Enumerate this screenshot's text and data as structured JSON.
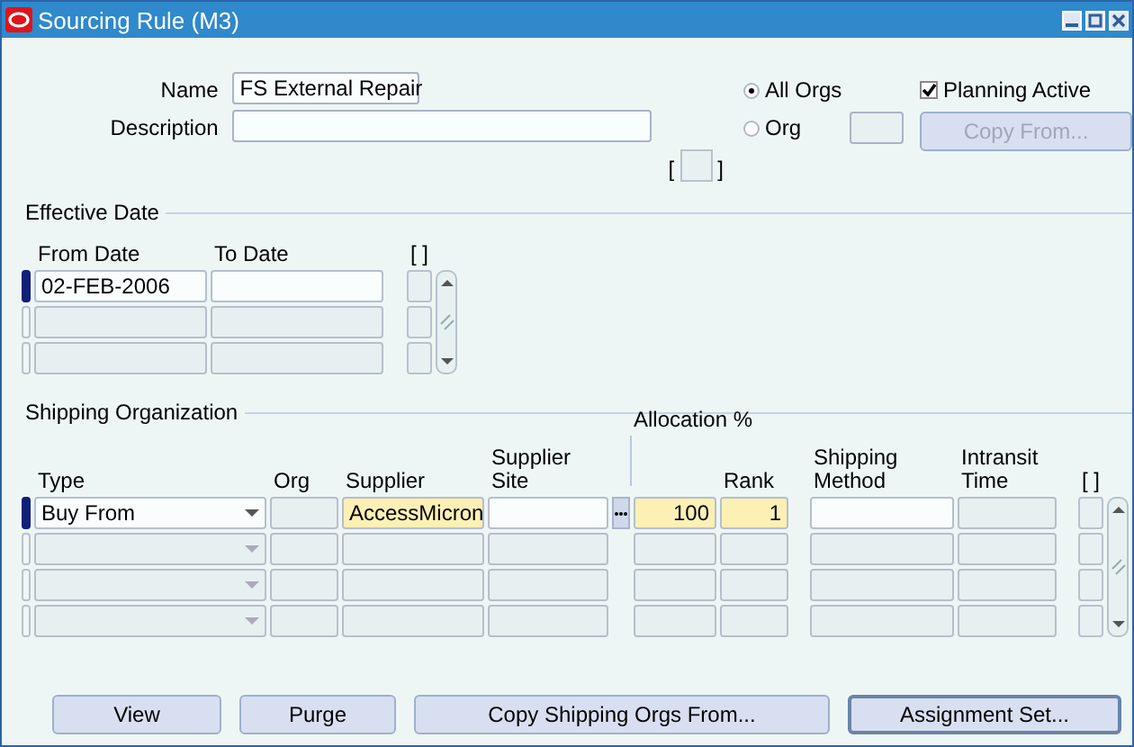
{
  "window": {
    "title": "Sourcing Rule (M3)"
  },
  "header": {
    "name_label": "Name",
    "name": "FS External Repair",
    "description_label": "Description",
    "flex_open": "[",
    "flex_close": "]",
    "scope": [
      {
        "label": "All Orgs",
        "selected": true
      },
      {
        "label": "Org",
        "selected": false
      }
    ],
    "planning_active": {
      "label": "Planning Active",
      "checked": true
    },
    "copy_from": {
      "label": "Copy From...",
      "disabled": true
    }
  },
  "effective_date": {
    "title": "Effective Date",
    "columns": [
      "From Date",
      "To Date"
    ],
    "flex_header": "[ ]",
    "rows": [
      {
        "selected": true,
        "from_date": "02-FEB-2006"
      },
      {
        "selected": false
      },
      {
        "selected": false
      }
    ]
  },
  "shipping": {
    "title": "Shipping Organization",
    "group_header": "Allocation %",
    "flex_header": "[ ]",
    "columns": [
      {
        "label": "Type",
        "kind": "select"
      },
      {
        "label": "Org",
        "kind": "readonly"
      },
      {
        "label": "Supplier",
        "kind": "required"
      },
      {
        "label": "Supplier Site",
        "kind": "lov"
      },
      {
        "kind": "required"
      },
      {
        "label": "Rank",
        "kind": "required"
      },
      {
        "label": "Shipping Method",
        "kind": "text"
      },
      {
        "label": "Intransit Time",
        "kind": "readonly"
      }
    ],
    "rows": [
      {
        "selected": true,
        "cells": {
          "type": "Buy From",
          "supplier": "AccessMicron",
          "allocation": "100",
          "rank": "1"
        }
      },
      {
        "selected": false,
        "cells": {}
      },
      {
        "selected": false,
        "cells": {}
      },
      {
        "selected": false,
        "cells": {}
      }
    ]
  },
  "buttons": [
    {
      "label": "View",
      "default": false
    },
    {
      "label": "Purge",
      "default": false
    },
    {
      "label": "Copy Shipping Orgs From...",
      "default": false
    },
    {
      "label": "Assignment Set...",
      "default": true
    }
  ]
}
